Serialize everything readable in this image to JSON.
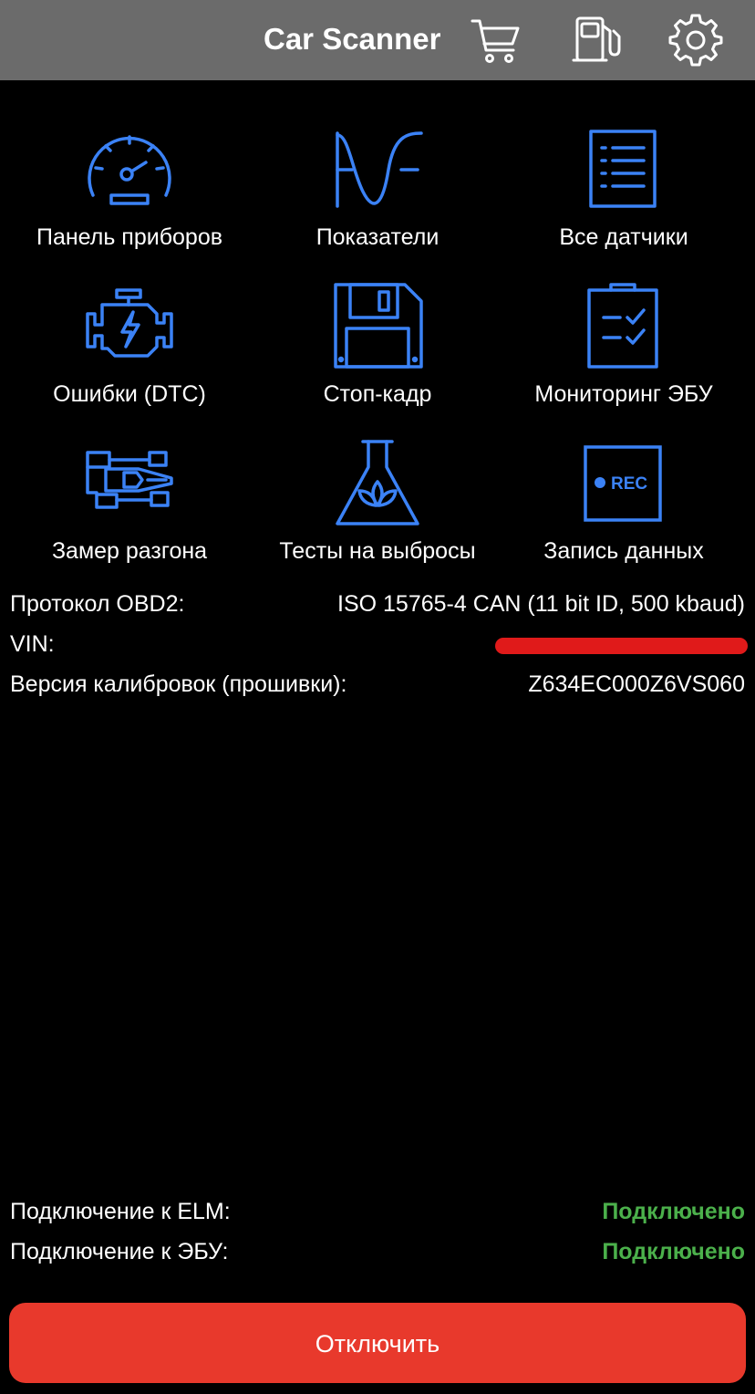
{
  "header": {
    "title": "Car Scanner",
    "icons": [
      "cart-icon",
      "fuel-pump-icon",
      "gear-icon"
    ],
    "background": "#6b6b6b"
  },
  "accent_color": "#3b82f6",
  "menu": [
    {
      "label": "Панель приборов",
      "icon": "dashboard-gauge-icon"
    },
    {
      "label": "Показатели",
      "icon": "sine-wave-icon"
    },
    {
      "label": "Все датчики",
      "icon": "list-icon"
    },
    {
      "label": "Ошибки (DTC)",
      "icon": "engine-icon"
    },
    {
      "label": "Стоп-кадр",
      "icon": "floppy-disk-icon"
    },
    {
      "label": "Мониторинг ЭБУ",
      "icon": "checklist-clipboard-icon"
    },
    {
      "label": "Замер разгона",
      "icon": "race-car-icon"
    },
    {
      "label": "Тесты на выбросы",
      "icon": "flask-leaf-icon"
    },
    {
      "label": "Запись данных",
      "icon": "rec-icon",
      "badge": "REC"
    }
  ],
  "info": {
    "protocol_label": "Протокол OBD2:",
    "protocol_value": "ISO 15765-4 CAN (11 bit ID, 500 kbaud)",
    "vin_label": "VIN:",
    "calibration_label": "Версия калибровок (прошивки):",
    "calibration_value": "Z634EC000Z6VS060"
  },
  "connection": {
    "elm_label": "Подключение к ELM:",
    "elm_status": "Подключено",
    "ecu_label": "Подключение к ЭБУ:",
    "ecu_status": "Подключено",
    "status_color": "#4bb04b"
  },
  "disconnect_button": {
    "label": "Отключить",
    "color": "#e8392c"
  }
}
